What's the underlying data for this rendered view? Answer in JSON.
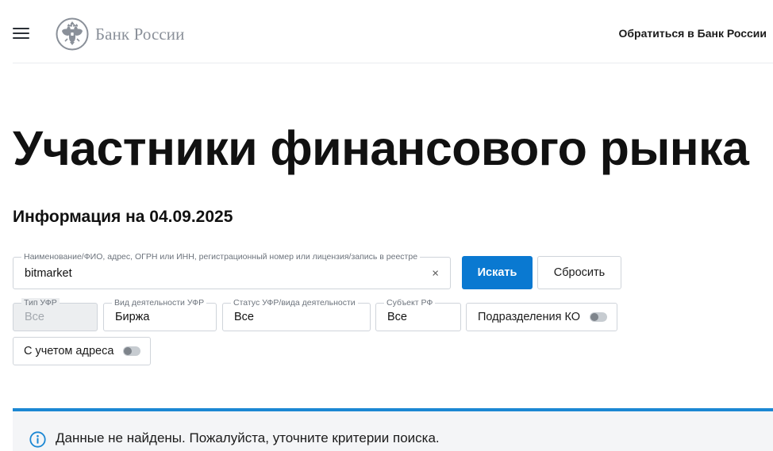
{
  "header": {
    "logo_text": "Банк России",
    "contact_link": "Обратиться в Банк России"
  },
  "page": {
    "title": "Участники финансового рынка",
    "subtitle": "Информация на 04.09.2025"
  },
  "search": {
    "legend": "Наименование/ФИО, адрес, ОГРН или ИНН, регистрационный номер или лицензия/запись в реестре",
    "value": "bitmarket",
    "clear_glyph": "×",
    "submit_label": "Искать",
    "reset_label": "Сбросить"
  },
  "filters": {
    "type": {
      "legend": "Тип УФР",
      "value": "Все",
      "disabled": true
    },
    "activity": {
      "legend": "Вид деятельности УФР",
      "value": "Биржа"
    },
    "status": {
      "legend": "Статус УФР/вида деятельности",
      "value": "Все"
    },
    "subject": {
      "legend": "Субъект РФ",
      "value": "Все"
    },
    "branches_toggle": {
      "label": "Подразделения КО",
      "checked": false
    },
    "address_toggle": {
      "label": "С учетом адреса",
      "checked": false
    }
  },
  "alert": {
    "icon": "info-icon",
    "message": "Данные не найдены. Пожалуйста, уточните критерии поиска.",
    "accent_color": "#1b87d3"
  },
  "colors": {
    "primary_button": "#0a79d1"
  }
}
